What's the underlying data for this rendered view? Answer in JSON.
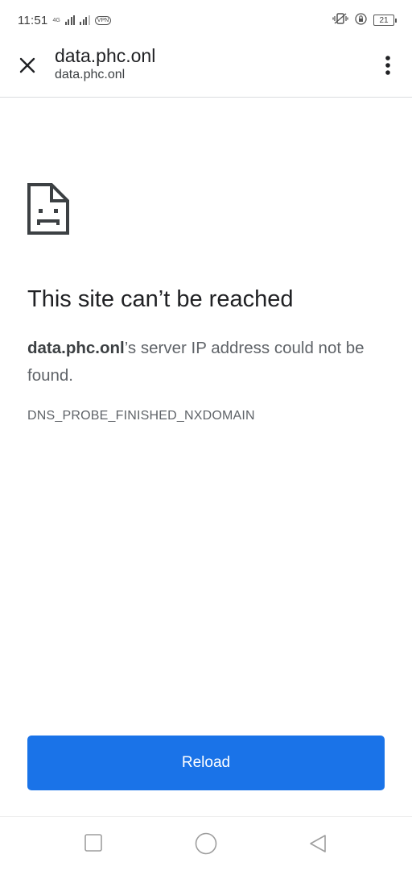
{
  "status_bar": {
    "time": "11:51",
    "network_label": "4G",
    "vpn_label": "VPN",
    "battery_level": "21"
  },
  "toolbar": {
    "title": "data.phc.onl",
    "url": "data.phc.onl",
    "close_icon": "close-icon",
    "menu_icon": "more-vert-icon"
  },
  "error_page": {
    "icon": "sad-page-icon",
    "heading": "This site can’t be reached",
    "domain": "data.phc.onl",
    "message_rest": "’s server IP address could not be found.",
    "error_code": "DNS_PROBE_FINISHED_NXDOMAIN",
    "reload_label": "Reload"
  },
  "colors": {
    "accent": "#1a73e8",
    "text_primary": "#202124",
    "text_secondary": "#5f6368"
  },
  "nav_bar": {
    "icons": [
      "recents-square-icon",
      "home-circle-icon",
      "back-triangle-icon"
    ]
  }
}
